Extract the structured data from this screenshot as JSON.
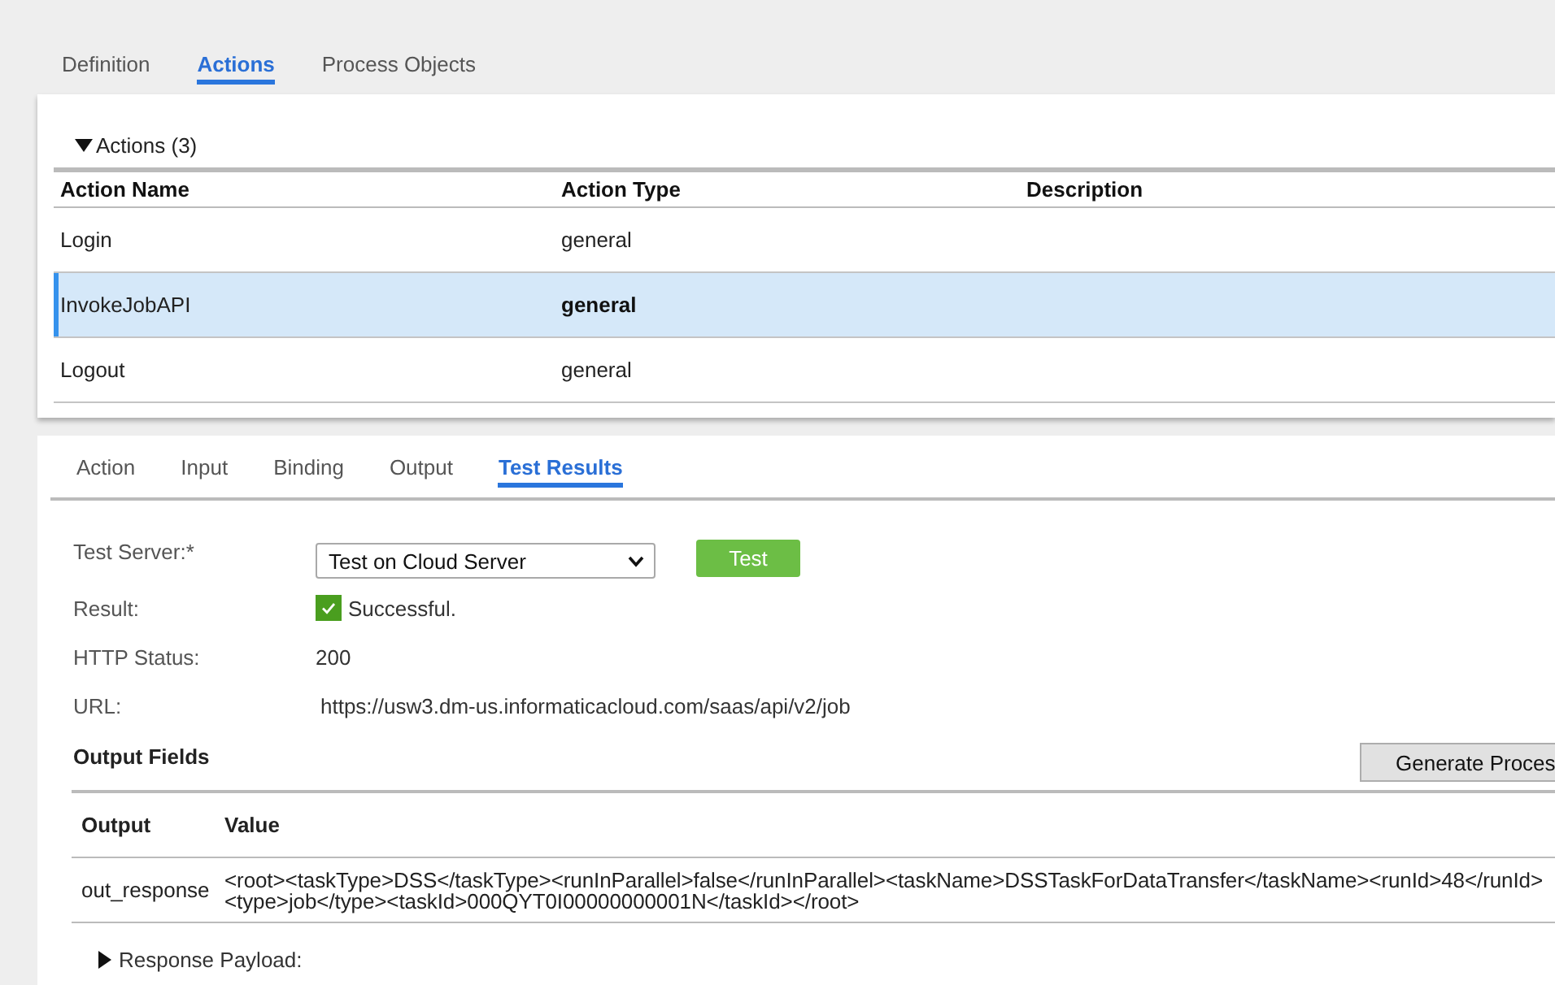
{
  "tabs": [
    {
      "label": "Definition",
      "selected": false
    },
    {
      "label": "Actions",
      "selected": true
    },
    {
      "label": "Process Objects",
      "selected": false
    }
  ],
  "actions": {
    "title": "Actions (3)",
    "expanded": true,
    "table": {
      "columns": [
        "Action Name",
        "Action Type",
        "Description"
      ],
      "rows": [
        {
          "action_name": "Login",
          "action_type": "general",
          "selected": false
        },
        {
          "action_name": "InvokeJobAPI",
          "action_type": "general",
          "selected": true
        },
        {
          "action_name": "Logout",
          "action_type": "general",
          "selected": false
        }
      ]
    }
  },
  "detail_tabs": [
    {
      "label": "Action",
      "selected": false
    },
    {
      "label": "Input",
      "selected": false
    },
    {
      "label": "Binding",
      "selected": false
    },
    {
      "label": "Output",
      "selected": false
    },
    {
      "label": "Test Results",
      "selected": true
    }
  ],
  "test_form": {
    "fields": [
      {
        "kind": "select",
        "label": "Test Server:*",
        "value": "Test on Cloud Server"
      },
      {
        "kind": "status",
        "label": "Result:",
        "value": "Successful.",
        "checked": true
      },
      {
        "kind": "text",
        "label": "HTTP Status:",
        "value": "200"
      },
      {
        "kind": "text",
        "label": "URL:",
        "value": "https://usw3.dm-us.informaticacloud.com/saas/api/v2/job"
      }
    ],
    "test_button": "Test"
  },
  "output_fields": {
    "title": "Output Fields",
    "button": "Generate Proces",
    "table": {
      "columns": [
        "Output",
        "Value"
      ],
      "rows": [
        {
          "output": "out_response",
          "value": "<root><taskType>DSS</taskType><runInParallel>false</runInParallel><taskName>DSSTaskForDataTransfer</taskName><runId>48</runId>\n<type>job</type><taskId>000QYT0I00000000001N</taskId></root>"
        }
      ]
    }
  },
  "response_payload": {
    "label": "Response Payload:",
    "expanded": false
  }
}
